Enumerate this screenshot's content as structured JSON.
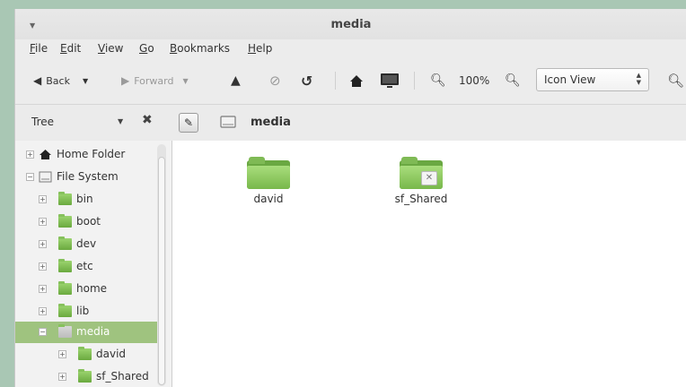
{
  "window": {
    "title": "media"
  },
  "menubar": {
    "items": [
      {
        "key": "F",
        "rest": "ile"
      },
      {
        "key": "E",
        "rest": "dit"
      },
      {
        "key": "V",
        "rest": "iew"
      },
      {
        "key": "G",
        "rest": "o"
      },
      {
        "key": "B",
        "rest": "ookmarks"
      },
      {
        "key": "H",
        "rest": "elp"
      }
    ]
  },
  "toolbar": {
    "back_label": "Back",
    "forward_label": "Forward",
    "zoom_level": "100%",
    "view_mode": "Icon View"
  },
  "location": {
    "sidebar_mode": "Tree",
    "path_segment": "media"
  },
  "tree": {
    "items": [
      {
        "label": "Home Folder"
      },
      {
        "label": "File System"
      },
      {
        "label": "bin"
      },
      {
        "label": "boot"
      },
      {
        "label": "dev"
      },
      {
        "label": "etc"
      },
      {
        "label": "home"
      },
      {
        "label": "lib"
      },
      {
        "label": "media"
      },
      {
        "label": "david"
      },
      {
        "label": "sf_Shared"
      }
    ]
  },
  "files": [
    {
      "name": "david"
    },
    {
      "name": "sf_Shared"
    }
  ],
  "colors": {
    "selection": "#9fc37f",
    "folder_green": "#78b84b"
  }
}
